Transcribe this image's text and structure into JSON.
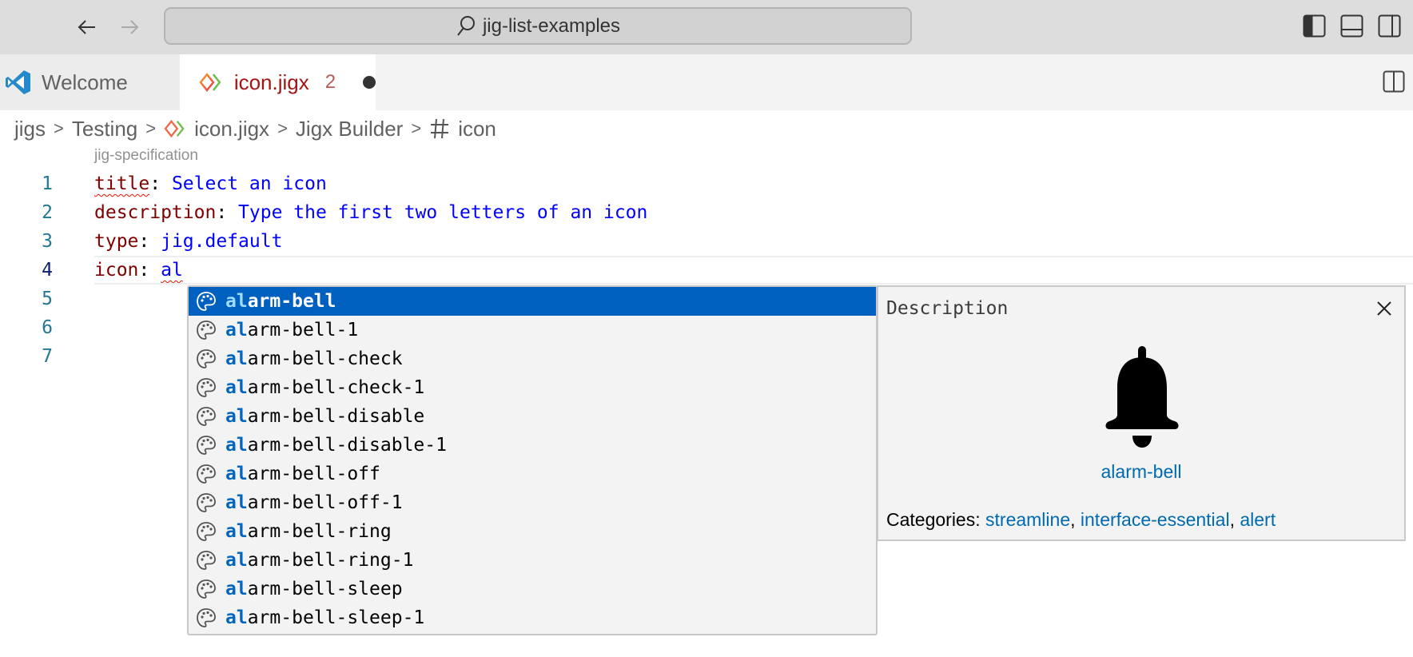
{
  "titlebar": {
    "back_icon": "arrow-left-icon",
    "forward_icon": "arrow-right-icon",
    "command_center_text": "jig-list-examples",
    "search_icon": "search-icon",
    "layout_icons": [
      "toggle-primary-sidebar-icon",
      "toggle-panel-icon",
      "toggle-secondary-sidebar-icon"
    ]
  },
  "tabs": [
    {
      "label": "Welcome",
      "icon": "vscode-logo-icon",
      "active": false
    },
    {
      "label": "icon.jigx",
      "icon": "jigx-file-icon",
      "problems": "2",
      "dirty": true,
      "active": true
    }
  ],
  "breadcrumb": {
    "items": [
      "jigs",
      "Testing",
      "icon.jigx",
      "Jigx Builder",
      "icon"
    ],
    "separator": ">",
    "symbol_icon": "number-sign-icon"
  },
  "codelens": "jig-specification",
  "editor": {
    "lines": [
      {
        "number": "1",
        "key": "title",
        "colon": ":",
        "value": " Select an icon"
      },
      {
        "number": "2",
        "key": "description",
        "colon": ":",
        "value": " Type the first two letters of an icon"
      },
      {
        "number": "3",
        "key": "type",
        "colon": ":",
        "value": " jig.default"
      },
      {
        "number": "4",
        "key": "icon",
        "colon": ":",
        "value_prefix": " ",
        "value": "al"
      },
      {
        "number": "5"
      },
      {
        "number": "6"
      },
      {
        "number": "7"
      }
    ]
  },
  "suggestions": {
    "match": "al",
    "selected_index": 0,
    "items": [
      {
        "match": "al",
        "rest": "arm-bell"
      },
      {
        "match": "al",
        "rest": "arm-bell-1"
      },
      {
        "match": "al",
        "rest": "arm-bell-check"
      },
      {
        "match": "al",
        "rest": "arm-bell-check-1"
      },
      {
        "match": "al",
        "rest": "arm-bell-disable"
      },
      {
        "match": "al",
        "rest": "arm-bell-disable-1"
      },
      {
        "match": "al",
        "rest": "arm-bell-off"
      },
      {
        "match": "al",
        "rest": "arm-bell-off-1"
      },
      {
        "match": "al",
        "rest": "arm-bell-ring"
      },
      {
        "match": "al",
        "rest": "arm-bell-ring-1"
      },
      {
        "match": "al",
        "rest": "arm-bell-sleep"
      },
      {
        "match": "al",
        "rest": "arm-bell-sleep-1"
      }
    ],
    "item_icon": "palette-icon"
  },
  "details": {
    "title": "Description",
    "icon_name": "alarm-bell",
    "preview_icon": "alarm-bell-icon",
    "categories_label": "Categories: ",
    "categories": [
      "streamline",
      "interface-essential",
      "alert"
    ],
    "separator": ", "
  },
  "colors": {
    "selection": "#0060c0",
    "match_highlight": "#0066bf",
    "yaml_key": "#800000",
    "yaml_value": "#0000ff",
    "link": "#006ab1",
    "error_squiggle": "#e51400"
  }
}
